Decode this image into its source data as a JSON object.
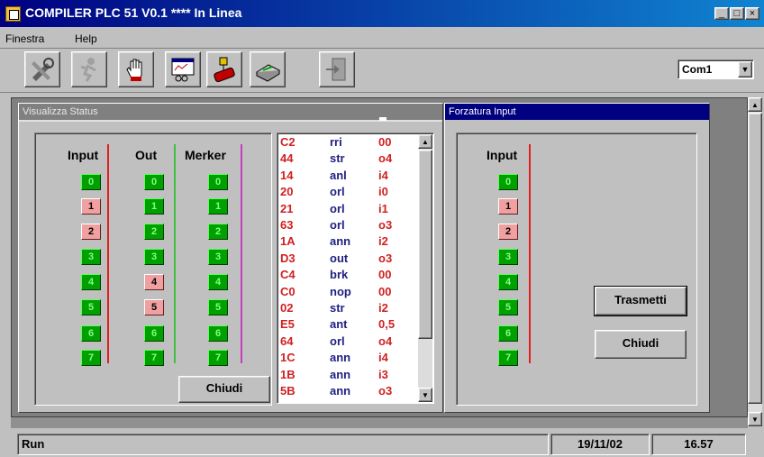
{
  "window": {
    "title": "COMPILER PLC 51 V0.1 **** In Linea",
    "controls": [
      "_",
      "□",
      "×"
    ]
  },
  "menu": {
    "items": [
      "Finestra",
      "Help"
    ]
  },
  "toolbar": {
    "tools": [
      "settings-tool",
      "run-tool",
      "stop-hand-tool",
      "monitor-tool",
      "plc-tool",
      "print-tool",
      "exit-tool"
    ],
    "com_port": "Com1"
  },
  "status_window": {
    "title": "Visualizza Status",
    "headers": {
      "input": "Input",
      "out": "Out",
      "merker": "Merker"
    },
    "bits": [
      "0",
      "1",
      "2",
      "3",
      "4",
      "5",
      "6",
      "7"
    ],
    "input_states": [
      1,
      0,
      0,
      1,
      1,
      1,
      1,
      1
    ],
    "out_states": [
      1,
      1,
      1,
      1,
      0,
      0,
      1,
      1
    ],
    "merker_states": [
      1,
      1,
      1,
      1,
      1,
      1,
      1,
      1
    ],
    "close_label": "Chiudi",
    "listing": [
      [
        "C2",
        "rri",
        "00"
      ],
      [
        "44",
        "str",
        "o4"
      ],
      [
        "14",
        "anl",
        "i4"
      ],
      [
        "20",
        "orl",
        "i0"
      ],
      [
        "21",
        "orl",
        "i1"
      ],
      [
        "63",
        "orl",
        "o3"
      ],
      [
        "1A",
        "ann",
        "i2"
      ],
      [
        "D3",
        "out",
        "o3"
      ],
      [
        "C4",
        "brk",
        "00"
      ],
      [
        "C0",
        "nop",
        "00"
      ],
      [
        "02",
        "str",
        "i2"
      ],
      [
        "E5",
        "ant",
        "0,5"
      ],
      [
        "64",
        "orl",
        "o4"
      ],
      [
        "1C",
        "ann",
        "i4"
      ],
      [
        "1B",
        "ann",
        "i3"
      ],
      [
        "5B",
        "ann",
        "o3"
      ]
    ]
  },
  "force_window": {
    "title": "Forzatura Input",
    "header": "Input",
    "bits": [
      "0",
      "1",
      "2",
      "3",
      "4",
      "5",
      "6",
      "7"
    ],
    "states": [
      1,
      0,
      0,
      1,
      1,
      1,
      1,
      1
    ],
    "send_label": "Trasmetti",
    "close_label": "Chiudi"
  },
  "statusbar": {
    "mode": "Run",
    "date": "19/11/02",
    "time": "16.57"
  },
  "colors": {
    "bit_on": "#00a000",
    "bit_off": "#f0a0a0",
    "input_line": "#e02020",
    "out_line": "#40c040",
    "merker_line": "#c040c0",
    "titlebar": "#000080"
  }
}
